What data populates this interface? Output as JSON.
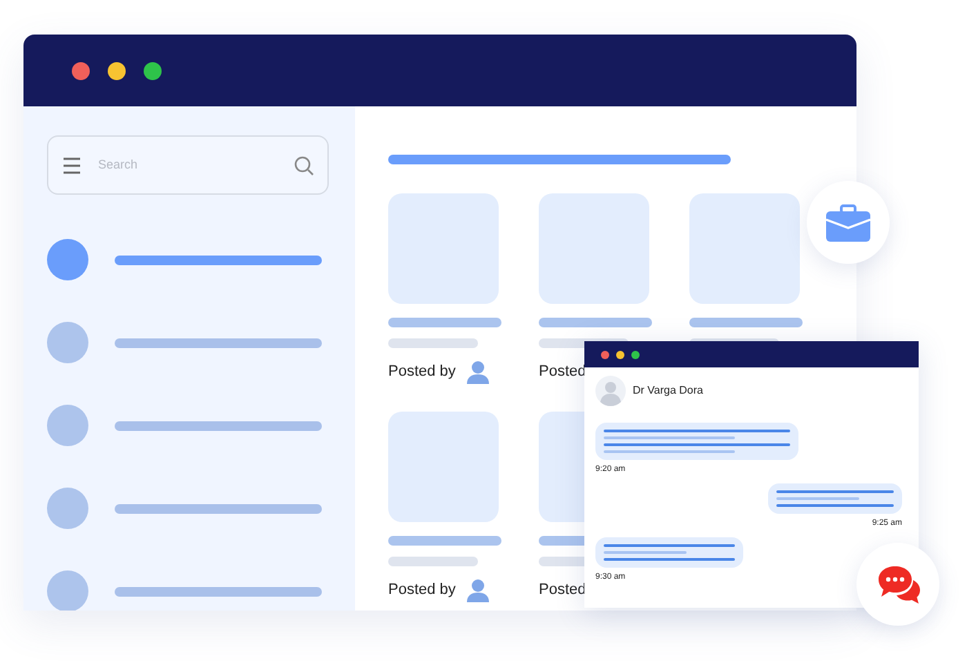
{
  "window": {
    "dots": [
      {
        "color": "#f0605a"
      },
      {
        "color": "#f7c331"
      },
      {
        "color": "#2ec34a"
      }
    ]
  },
  "search": {
    "placeholder": "Search"
  },
  "sidebar": {
    "items": [
      {
        "selected": true
      },
      {
        "selected": false
      },
      {
        "selected": false
      },
      {
        "selected": false
      },
      {
        "selected": false
      }
    ]
  },
  "cards": [
    {
      "label": "Posted by",
      "author_icon": true
    },
    {
      "label": "Posted",
      "author_icon": false
    },
    {
      "author_icon": false
    },
    {
      "label": "Posted by",
      "author_icon": true
    },
    {
      "label": "Posted",
      "author_icon": false
    }
  ],
  "chat": {
    "dots": [
      {
        "color": "#f0605a"
      },
      {
        "color": "#f7c331"
      },
      {
        "color": "#2ec34a"
      }
    ],
    "contact": {
      "name": "Dr Varga Dora"
    },
    "messages": [
      {
        "outgoing": false,
        "time": "9:20 am",
        "lines": [
          {
            "faint": false
          },
          {
            "faint": true
          },
          {
            "faint": false
          },
          {
            "faint": true
          }
        ]
      },
      {
        "outgoing": true,
        "time": "9:25 am",
        "lines": [
          {
            "faint": false
          },
          {
            "faint": true
          },
          {
            "faint": false
          }
        ]
      },
      {
        "outgoing": false,
        "time": "9:30 am",
        "lines": [
          {
            "faint": false
          },
          {
            "faint": true
          },
          {
            "faint": false
          }
        ]
      }
    ]
  }
}
